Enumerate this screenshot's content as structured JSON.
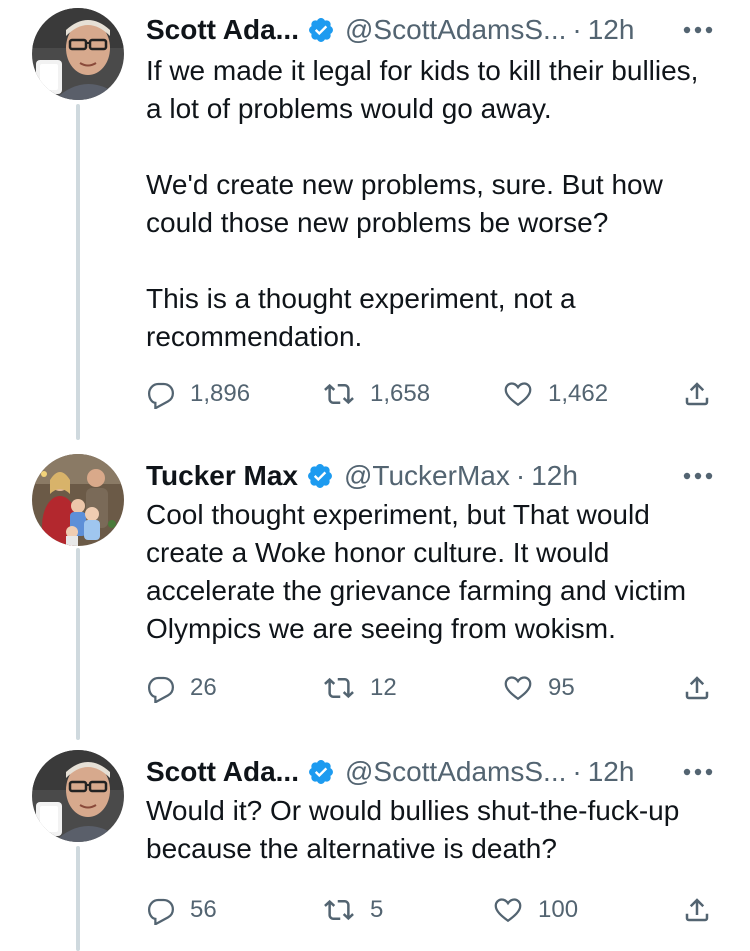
{
  "tweets": [
    {
      "display_name": "Scott Ada...",
      "handle": "@ScottAdamsS...",
      "separator": "·",
      "time": "12h",
      "text": "If we made it legal for kids to kill their bullies, a lot of problems would go away.\n\nWe'd create new problems, sure. But how could those new problems be worse?\n\nThis is a thought experiment, not a recommendation.",
      "replies": "1,896",
      "retweets": "1,658",
      "likes": "1,462"
    },
    {
      "display_name": "Tucker Max",
      "handle": "@TuckerMax",
      "separator": "·",
      "time": "12h",
      "text": "Cool thought experiment, but That would create a Woke honor culture. It would accelerate the grievance farming and victim Olympics we are seeing from wokism.",
      "replies": "26",
      "retweets": "12",
      "likes": "95"
    },
    {
      "display_name": "Scott Ada...",
      "handle": "@ScottAdamsS...",
      "separator": "·",
      "time": "12h",
      "text": "Would it? Or would bullies shut-the-fuck-up because the alternative is death?",
      "replies": "56",
      "retweets": "5",
      "likes": "100"
    }
  ],
  "icons": {
    "verified": "verified-badge-icon",
    "more": "more-options-icon",
    "reply": "reply-icon",
    "retweet": "retweet-icon",
    "like": "heart-icon",
    "share": "share-icon"
  },
  "colors": {
    "verified": "#1d9bf0",
    "secondary_text": "#536471",
    "thread_line": "#cfd9de"
  }
}
